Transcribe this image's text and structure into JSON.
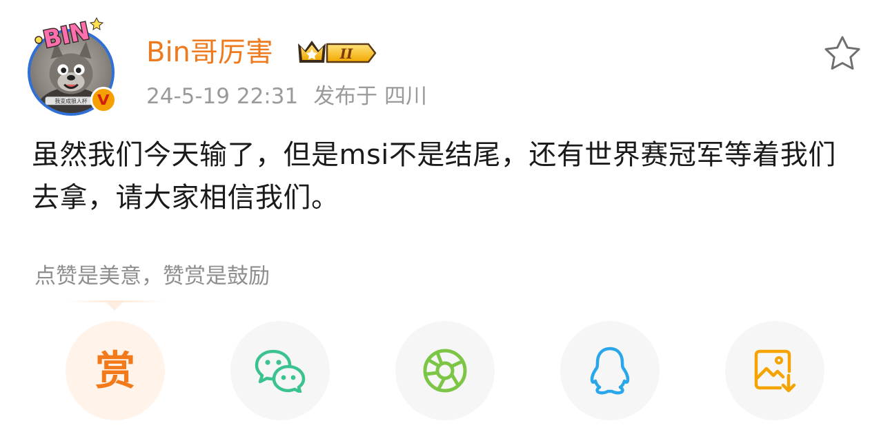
{
  "post": {
    "author": "Bin哥厉害",
    "vip_level": "II",
    "timestamp": "24-5-19 22:31",
    "location": "发布于 四川",
    "content": "虽然我们今天输了，但是msi不是结尾，还有世界赛冠军等着我们去拿，请大家相信我们。"
  },
  "avatar": {
    "badge_text": "BIN",
    "caption": "我变成狼人杯"
  },
  "verified_mark": "V",
  "reward": {
    "tip": "点赞是美意，赞赏是鼓励",
    "reward_label": "赏"
  },
  "share_targets": [
    {
      "name": "reward",
      "icon": "reward-icon",
      "color": "#f27a1a"
    },
    {
      "name": "wechat",
      "icon": "wechat-icon",
      "color": "#3bc28f"
    },
    {
      "name": "moments",
      "icon": "moments-aperture-icon",
      "color": "#7cc546"
    },
    {
      "name": "qq",
      "icon": "qq-penguin-icon",
      "color": "#2aa7ea"
    },
    {
      "name": "save-image",
      "icon": "save-image-icon",
      "color": "#f5a300"
    }
  ],
  "colors": {
    "author": "#ef7a1d",
    "meta": "#9a9a9a",
    "avatar_ring": "#2f6fd6",
    "verified": "#f5a000"
  }
}
